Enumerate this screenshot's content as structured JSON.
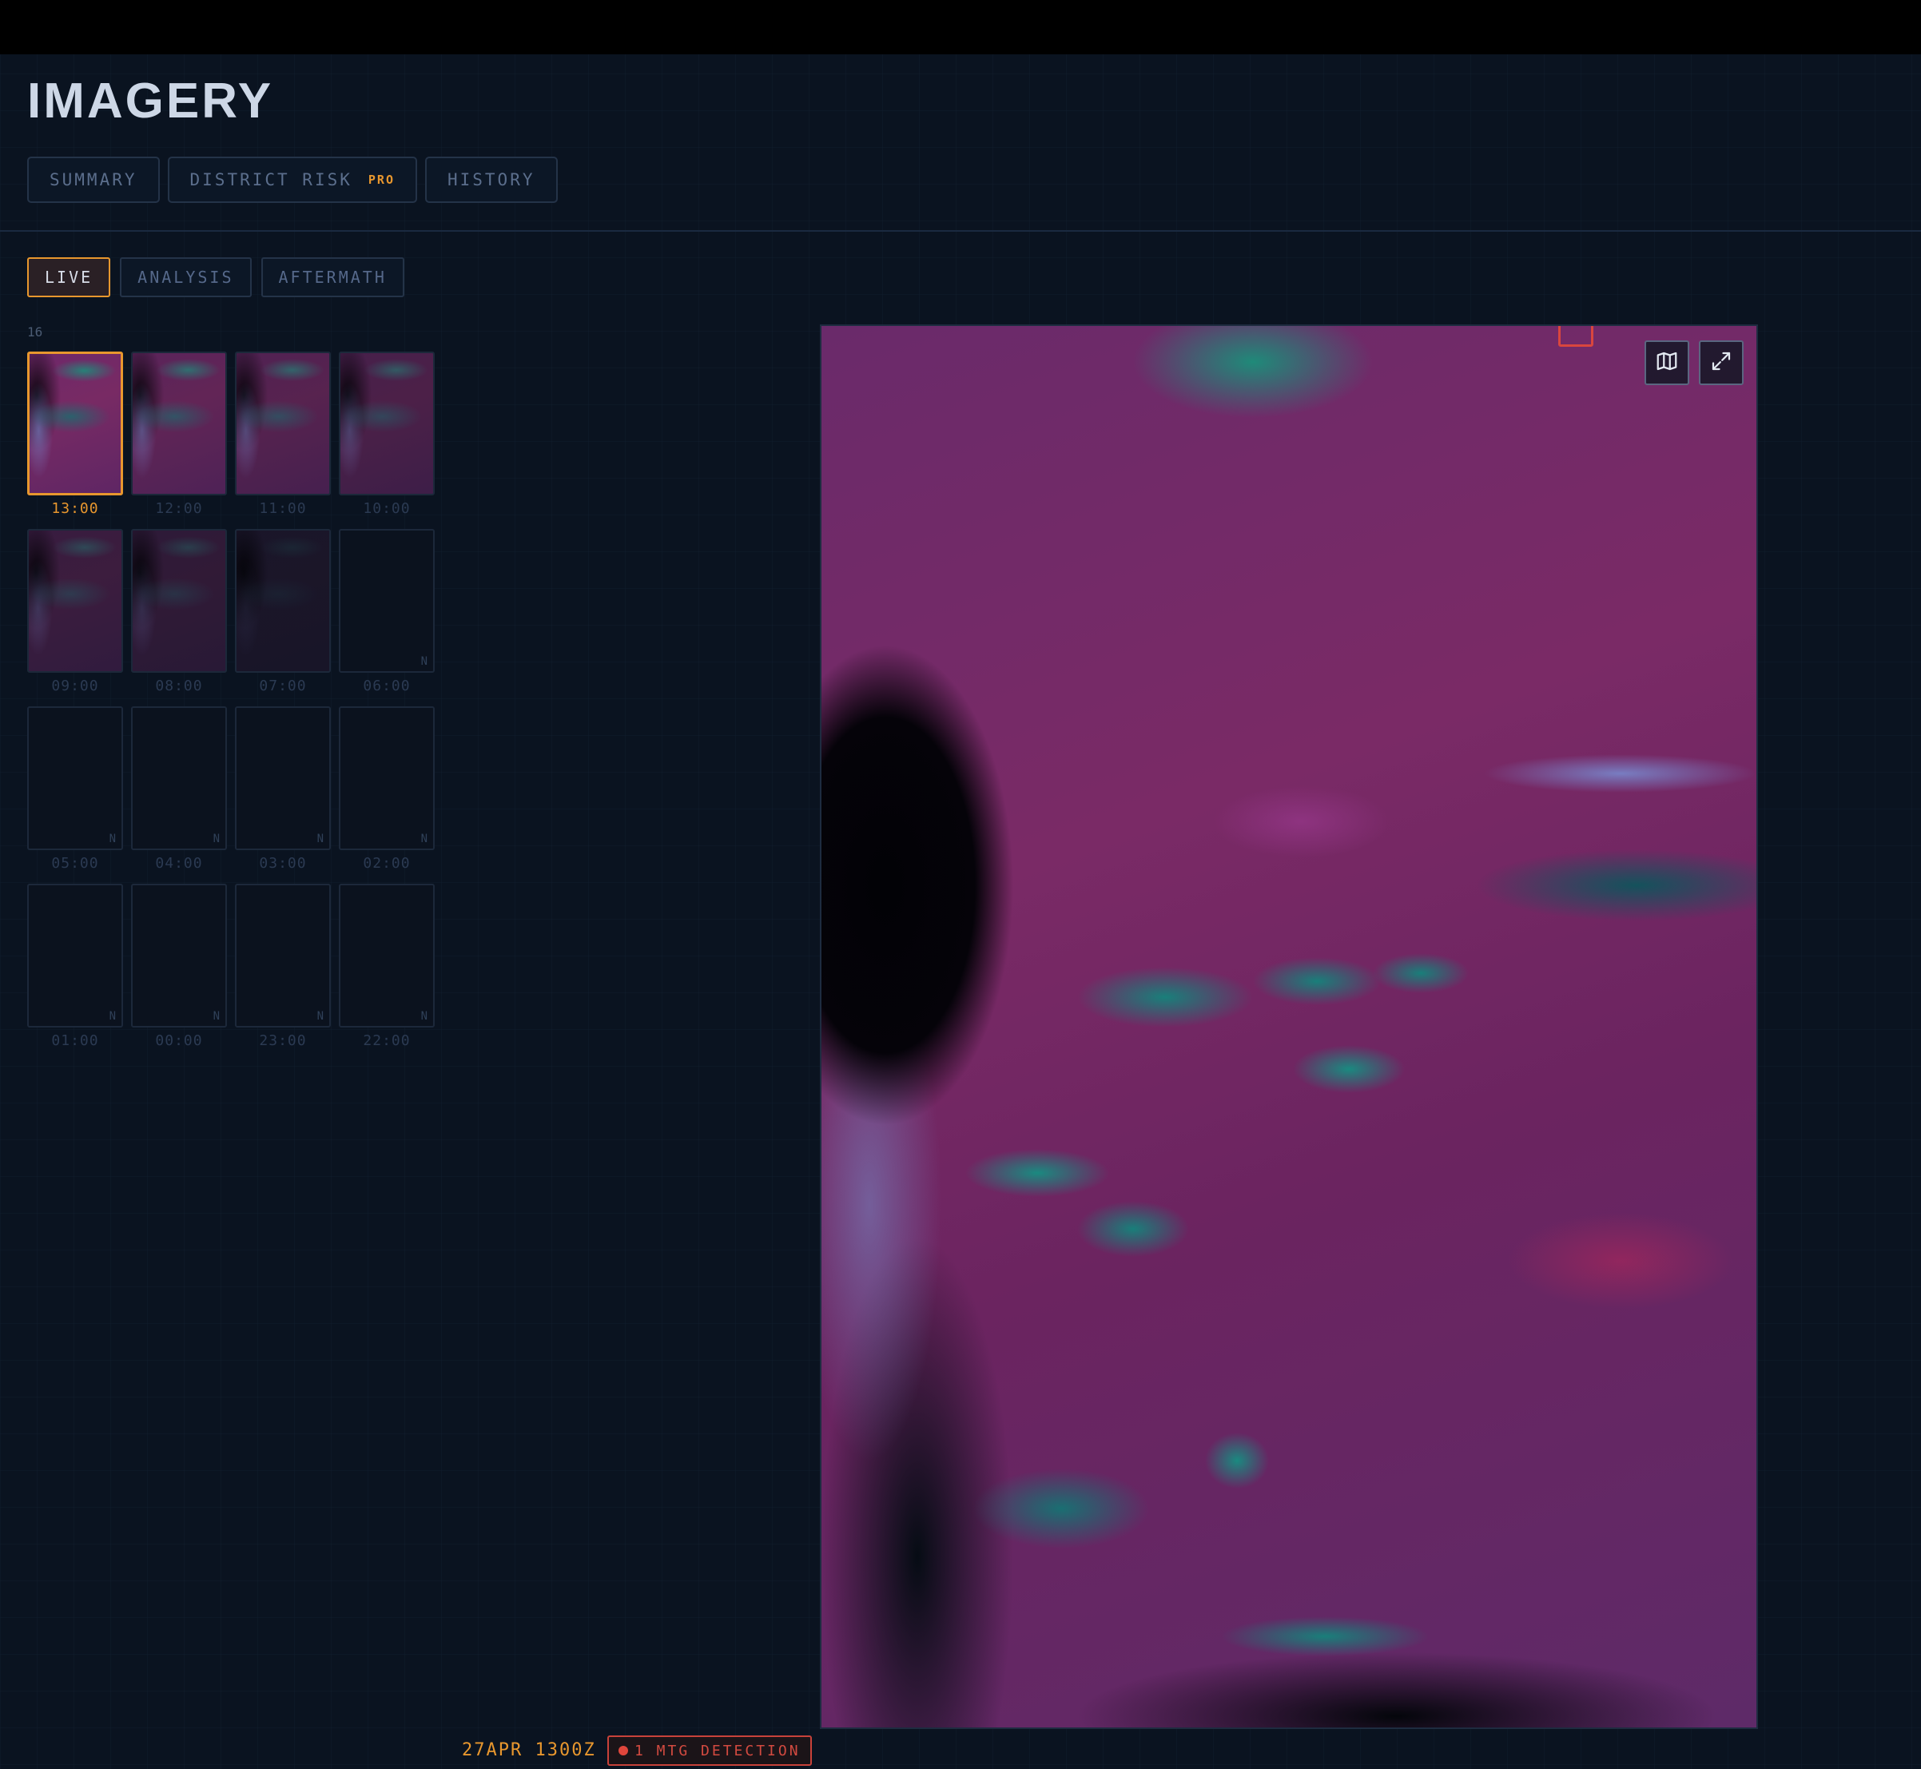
{
  "page": {
    "title": "IMAGERY"
  },
  "tabs": [
    {
      "label": "SUMMARY"
    },
    {
      "label": "DISTRICT RISK",
      "badge": "PRO"
    },
    {
      "label": "HISTORY"
    }
  ],
  "modes": [
    {
      "label": "LIVE",
      "active": true
    },
    {
      "label": "ANALYSIS",
      "active": false
    },
    {
      "label": "AFTERMATH",
      "active": false
    }
  ],
  "frames": {
    "count": "16",
    "no_data_marker": "N",
    "selected": "13:00",
    "items": [
      {
        "time": "13:00",
        "brightness": 1.0,
        "no_data": false
      },
      {
        "time": "12:00",
        "brightness": 0.8,
        "no_data": false
      },
      {
        "time": "11:00",
        "brightness": 0.7,
        "no_data": false
      },
      {
        "time": "10:00",
        "brightness": 0.6,
        "no_data": false
      },
      {
        "time": "09:00",
        "brightness": 0.45,
        "no_data": false
      },
      {
        "time": "08:00",
        "brightness": 0.35,
        "no_data": false
      },
      {
        "time": "07:00",
        "brightness": 0.15,
        "no_data": false
      },
      {
        "time": "06:00",
        "brightness": 0.0,
        "no_data": true
      },
      {
        "time": "05:00",
        "brightness": 0.0,
        "no_data": true
      },
      {
        "time": "04:00",
        "brightness": 0.0,
        "no_data": true
      },
      {
        "time": "03:00",
        "brightness": 0.0,
        "no_data": true
      },
      {
        "time": "02:00",
        "brightness": 0.0,
        "no_data": true
      },
      {
        "time": "01:00",
        "brightness": 0.0,
        "no_data": true
      },
      {
        "time": "00:00",
        "brightness": 0.0,
        "no_data": true
      },
      {
        "time": "23:00",
        "brightness": 0.0,
        "no_data": true
      },
      {
        "time": "22:00",
        "brightness": 0.0,
        "no_data": true
      }
    ]
  },
  "viewer": {
    "controls": [
      {
        "name": "map-icon"
      },
      {
        "name": "expand-icon"
      }
    ]
  },
  "status": {
    "timestamp": "27APR 1300Z",
    "detection": "1 MTG DETECTION"
  },
  "colors": {
    "accent": "#e8972e",
    "alert": "#d9463e",
    "background": "#0a1320"
  }
}
